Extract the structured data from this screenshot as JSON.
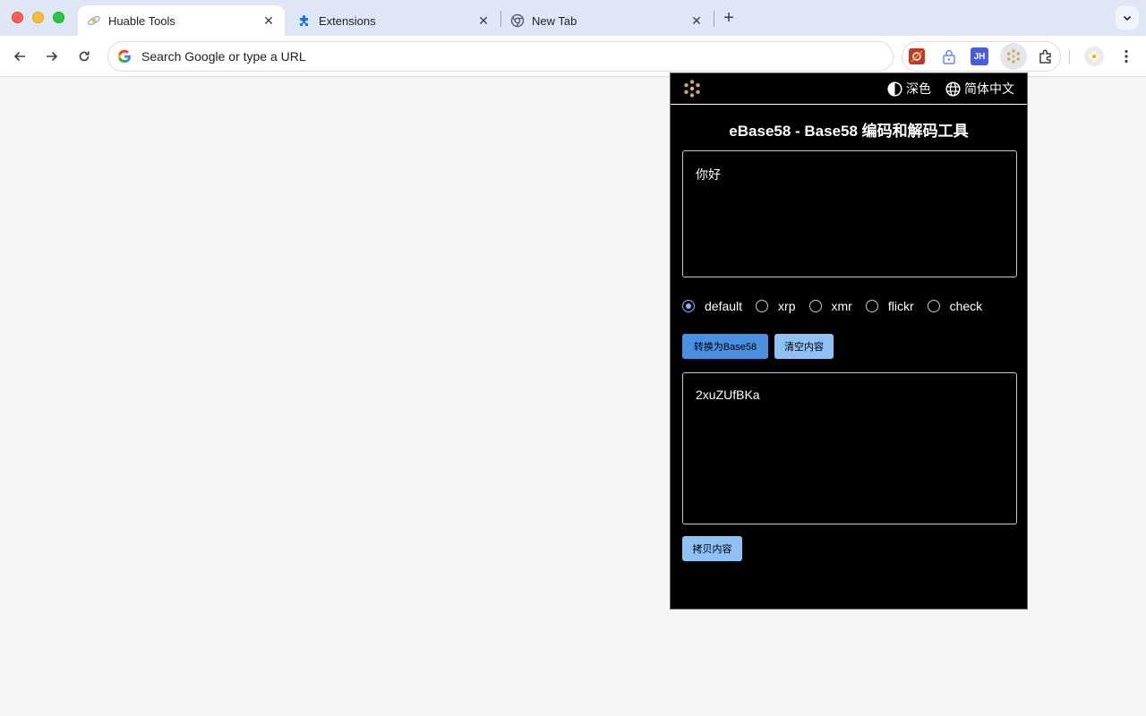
{
  "browser": {
    "tabs": [
      {
        "title": "Huable Tools",
        "favicon": "huable-logo-icon",
        "active": true
      },
      {
        "title": "Extensions",
        "favicon": "puzzle-piece-icon",
        "active": false
      },
      {
        "title": "New Tab",
        "favicon": "chrome-icon",
        "active": false
      }
    ],
    "omnibox": {
      "placeholder": "Search Google or type a URL",
      "value": ""
    },
    "extensions": [
      "red-extension-icon",
      "lock-extension-icon",
      "jh-extension-icon",
      "huable-extension-icon",
      "puzzle-extensions-icon"
    ],
    "jh_label": "JH"
  },
  "popup": {
    "theme_label": "深色",
    "language_label": "简体中文",
    "title": "eBase58 - Base58 编码和解码工具",
    "input_value": "你好",
    "options": [
      "default",
      "xrp",
      "xmr",
      "flickr",
      "check"
    ],
    "selected_option": "default",
    "convert_label": "转换为Base58",
    "clear_label": "清空内容",
    "output_value": "2xuZUfBKa",
    "copy_label": "拷贝内容"
  },
  "colors": {
    "tabstrip_bg": "#dfe6f5",
    "popup_bg": "#000000",
    "primary_button": "#4a90e2",
    "secondary_button": "#90c1f5",
    "radio_accent": "#8ab4f8"
  }
}
